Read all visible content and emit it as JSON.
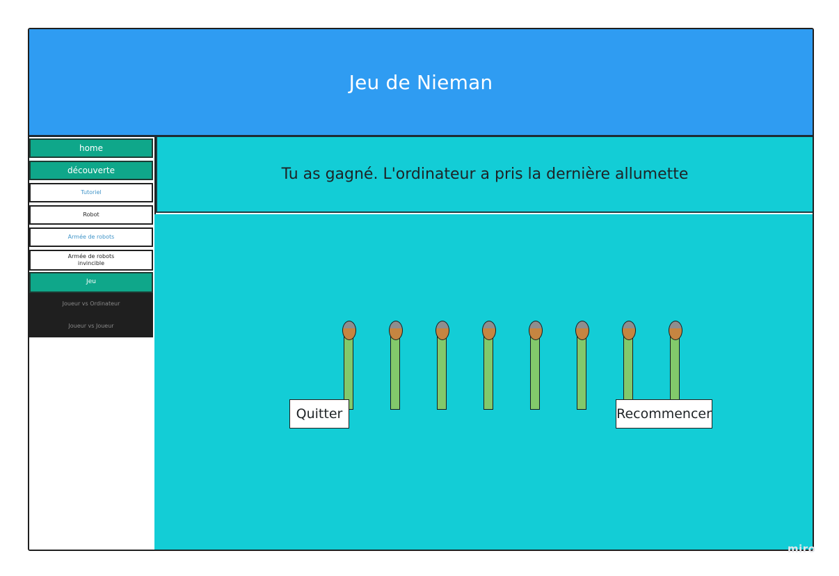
{
  "header": {
    "title": "Jeu de Nieman"
  },
  "sidebar": {
    "items": [
      {
        "label": "home"
      },
      {
        "label": "découverte"
      },
      {
        "label": "Tutoriel"
      },
      {
        "label": "Robot"
      },
      {
        "label": "Armée de robots"
      },
      {
        "label": "Armée de robots invincible"
      },
      {
        "label": "Jeu"
      },
      {
        "label": "Joueur vs Ordinateur"
      },
      {
        "label": "Joueur vs Joueur"
      }
    ]
  },
  "message": {
    "text": "Tu as gagné. L'ordinateur a pris la dernière allumette"
  },
  "game": {
    "matches_remaining": 8
  },
  "buttons": {
    "quit_label": "Quitter",
    "restart_label": "Recommencer"
  },
  "watermark": {
    "text": "miro"
  },
  "colors": {
    "header_bg": "#2f9cf2",
    "game_bg": "#13cdd6",
    "nav_active": "#0fa78a",
    "nav_dark": "#1f1f1f",
    "match_stick": "#82c96b",
    "match_head": "#c58541"
  }
}
